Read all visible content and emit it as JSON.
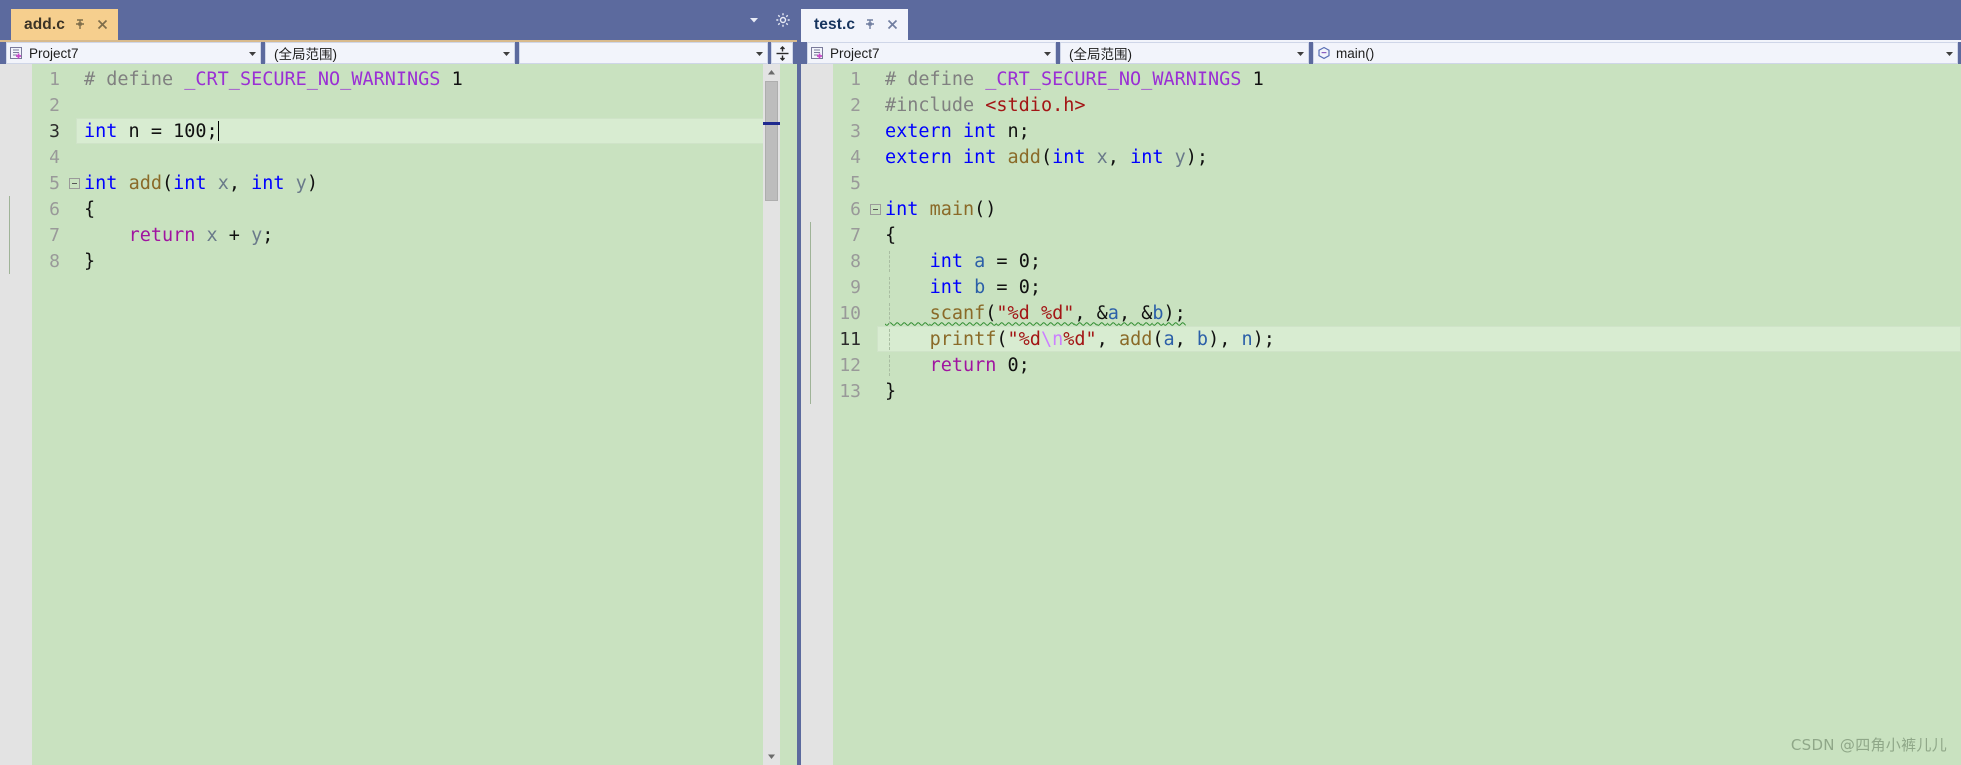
{
  "theme": {
    "chrome_bg": "#5c6a9e",
    "editor_bg": "#c9e2c0",
    "active_tab_bg": "#f6cf8e",
    "focus_tab_bg": "#f2f4fb",
    "current_line_bg": "#d8ecd1",
    "gutter_bg": "#e3e3e3",
    "scroll_marker": "#1f2a8f",
    "keyword": "#0000ff",
    "control": "#a014a0",
    "function": "#8a6a28",
    "string": "#a31515",
    "escape": "#cc80ff",
    "macro": "#9a2fd4",
    "preprocessor": "#808080",
    "squiggle": "#2e8b2e"
  },
  "left_pane": {
    "tab": {
      "label": "add.c",
      "pin_icon": "pin-icon",
      "close_icon": "close-icon",
      "state": "active"
    },
    "strip_icons": [
      {
        "name": "tab-list-chevron-down-icon",
        "glyph": "▾"
      },
      {
        "name": "gear-icon",
        "glyph": "⚙"
      }
    ],
    "navbar": {
      "project_combo": {
        "value": "Project7",
        "icon": "project-add-icon",
        "arrow": "chevron-down-icon"
      },
      "scope_combo": {
        "value": "(全局范围)",
        "arrow": "chevron-down-icon"
      },
      "member_combo": {
        "value": "",
        "arrow": "chevron-down-icon"
      },
      "split_window_icon": "split-window-icon"
    },
    "scrollbar": {
      "up_arrow": "▲",
      "down_arrow": "▼",
      "marker_label": "changed-line-marker"
    },
    "current_line": 3,
    "code_lines": [
      {
        "n": 1,
        "fold": "",
        "tokens": [
          {
            "t": "# define ",
            "c": "t-pre"
          },
          {
            "t": "_CRT_SECURE_NO_WARNINGS",
            "c": "t-macro"
          },
          {
            "t": " 1",
            "c": "t-plain"
          }
        ]
      },
      {
        "n": 2,
        "fold": "",
        "tokens": []
      },
      {
        "n": 3,
        "fold": "",
        "current": true,
        "tokens": [
          {
            "t": "int",
            "c": "t-kw"
          },
          {
            "t": " n ",
            "c": "t-plain"
          },
          {
            "t": "=",
            "c": "t-op"
          },
          {
            "t": " ",
            "c": "t-plain"
          },
          {
            "t": "100",
            "c": "t-num"
          },
          {
            "t": ";",
            "c": "t-plain"
          }
        ],
        "caret": true
      },
      {
        "n": 4,
        "fold": "",
        "tokens": []
      },
      {
        "n": 5,
        "fold": "collapse",
        "tokens": [
          {
            "t": "int",
            "c": "t-kw"
          },
          {
            "t": " ",
            "c": "t-plain"
          },
          {
            "t": "add",
            "c": "t-fn"
          },
          {
            "t": "(",
            "c": "t-plain"
          },
          {
            "t": "int",
            "c": "t-kw"
          },
          {
            "t": " ",
            "c": "t-plain"
          },
          {
            "t": "x",
            "c": "t-var"
          },
          {
            "t": ", ",
            "c": "t-plain"
          },
          {
            "t": "int",
            "c": "t-kw"
          },
          {
            "t": " ",
            "c": "t-plain"
          },
          {
            "t": "y",
            "c": "t-var"
          },
          {
            "t": ")",
            "c": "t-plain"
          }
        ]
      },
      {
        "n": 6,
        "fold": "bar",
        "tokens": [
          {
            "t": "{",
            "c": "t-plain"
          }
        ]
      },
      {
        "n": 7,
        "fold": "bar",
        "tokens": [
          {
            "t": "    ",
            "c": "t-plain"
          },
          {
            "t": "return",
            "c": "t-ctl"
          },
          {
            "t": " ",
            "c": "t-plain"
          },
          {
            "t": "x",
            "c": "t-var"
          },
          {
            "t": " + ",
            "c": "t-plain"
          },
          {
            "t": "y",
            "c": "t-var"
          },
          {
            "t": ";",
            "c": "t-plain"
          }
        ]
      },
      {
        "n": 8,
        "fold": "bar",
        "tokens": [
          {
            "t": "}",
            "c": "t-plain"
          }
        ]
      }
    ]
  },
  "right_pane": {
    "tab": {
      "label": "test.c",
      "pin_icon": "pin-icon",
      "close_icon": "close-icon",
      "state": "focused"
    },
    "navbar": {
      "project_combo": {
        "value": "Project7",
        "icon": "project-add-icon",
        "arrow": "chevron-down-icon"
      },
      "scope_combo": {
        "value": "(全局范围)",
        "arrow": "chevron-down-icon"
      },
      "member_combo": {
        "value": "main()",
        "icon": "method-icon",
        "arrow": "chevron-down-icon"
      }
    },
    "current_line": 11,
    "code_lines": [
      {
        "n": 1,
        "fold": "",
        "tokens": [
          {
            "t": "# define ",
            "c": "t-pre"
          },
          {
            "t": "_CRT_SECURE_NO_WARNINGS",
            "c": "t-macro"
          },
          {
            "t": " 1",
            "c": "t-plain"
          }
        ]
      },
      {
        "n": 2,
        "fold": "",
        "tokens": [
          {
            "t": "#include ",
            "c": "t-pre"
          },
          {
            "t": "<stdio.h>",
            "c": "t-inc"
          }
        ]
      },
      {
        "n": 3,
        "fold": "",
        "tokens": [
          {
            "t": "extern",
            "c": "t-kw"
          },
          {
            "t": " ",
            "c": "t-plain"
          },
          {
            "t": "int",
            "c": "t-kw"
          },
          {
            "t": " n;",
            "c": "t-plain"
          }
        ]
      },
      {
        "n": 4,
        "fold": "",
        "tokens": [
          {
            "t": "extern",
            "c": "t-kw"
          },
          {
            "t": " ",
            "c": "t-plain"
          },
          {
            "t": "int",
            "c": "t-kw"
          },
          {
            "t": " ",
            "c": "t-plain"
          },
          {
            "t": "add",
            "c": "t-fn"
          },
          {
            "t": "(",
            "c": "t-plain"
          },
          {
            "t": "int",
            "c": "t-kw"
          },
          {
            "t": " ",
            "c": "t-plain"
          },
          {
            "t": "x",
            "c": "t-var"
          },
          {
            "t": ", ",
            "c": "t-plain"
          },
          {
            "t": "int",
            "c": "t-kw"
          },
          {
            "t": " ",
            "c": "t-plain"
          },
          {
            "t": "y",
            "c": "t-var"
          },
          {
            "t": ");",
            "c": "t-plain"
          }
        ]
      },
      {
        "n": 5,
        "fold": "",
        "tokens": []
      },
      {
        "n": 6,
        "fold": "collapse",
        "tokens": [
          {
            "t": "int",
            "c": "t-kw"
          },
          {
            "t": " ",
            "c": "t-plain"
          },
          {
            "t": "main",
            "c": "t-fn"
          },
          {
            "t": "()",
            "c": "t-plain"
          }
        ]
      },
      {
        "n": 7,
        "fold": "bar",
        "tokens": [
          {
            "t": "{",
            "c": "t-plain"
          }
        ]
      },
      {
        "n": 8,
        "fold": "bar",
        "dashed": true,
        "tokens": [
          {
            "t": "    ",
            "c": "t-plain"
          },
          {
            "t": "int",
            "c": "t-kw"
          },
          {
            "t": " ",
            "c": "t-plain"
          },
          {
            "t": "a",
            "c": "t-varb"
          },
          {
            "t": " = ",
            "c": "t-plain"
          },
          {
            "t": "0",
            "c": "t-num"
          },
          {
            "t": ";",
            "c": "t-plain"
          }
        ]
      },
      {
        "n": 9,
        "fold": "bar",
        "dashed": true,
        "tokens": [
          {
            "t": "    ",
            "c": "t-plain"
          },
          {
            "t": "int",
            "c": "t-kw"
          },
          {
            "t": " ",
            "c": "t-plain"
          },
          {
            "t": "b",
            "c": "t-varb"
          },
          {
            "t": " = ",
            "c": "t-plain"
          },
          {
            "t": "0",
            "c": "t-num"
          },
          {
            "t": ";",
            "c": "t-plain"
          }
        ]
      },
      {
        "n": 10,
        "fold": "bar",
        "dashed": true,
        "squiggle": true,
        "tokens": [
          {
            "t": "    ",
            "c": "t-plain"
          },
          {
            "t": "scanf",
            "c": "t-fn"
          },
          {
            "t": "(",
            "c": "t-plain"
          },
          {
            "t": "\"%d %d\"",
            "c": "t-str"
          },
          {
            "t": ", ",
            "c": "t-plain"
          },
          {
            "t": "&",
            "c": "t-plain"
          },
          {
            "t": "a",
            "c": "t-varb"
          },
          {
            "t": ", ",
            "c": "t-plain"
          },
          {
            "t": "&",
            "c": "t-plain"
          },
          {
            "t": "b",
            "c": "t-varb"
          },
          {
            "t": ");",
            "c": "t-plain"
          }
        ]
      },
      {
        "n": 11,
        "fold": "bar",
        "dashed": true,
        "current": true,
        "tokens": [
          {
            "t": "    ",
            "c": "t-plain"
          },
          {
            "t": "printf",
            "c": "t-fn"
          },
          {
            "t": "(",
            "c": "t-plain"
          },
          {
            "t": "\"%d",
            "c": "t-str"
          },
          {
            "t": "\\n",
            "c": "t-esc"
          },
          {
            "t": "%d\"",
            "c": "t-str"
          },
          {
            "t": ", ",
            "c": "t-plain"
          },
          {
            "t": "add",
            "c": "t-fn"
          },
          {
            "t": "(",
            "c": "t-plain"
          },
          {
            "t": "a",
            "c": "t-varb"
          },
          {
            "t": ", ",
            "c": "t-plain"
          },
          {
            "t": "b",
            "c": "t-varb"
          },
          {
            "t": "), ",
            "c": "t-plain"
          },
          {
            "t": "n",
            "c": "t-varb"
          },
          {
            "t": ");",
            "c": "t-plain"
          }
        ]
      },
      {
        "n": 12,
        "fold": "bar",
        "dashed": true,
        "tokens": [
          {
            "t": "    ",
            "c": "t-plain"
          },
          {
            "t": "return",
            "c": "t-ctl"
          },
          {
            "t": " ",
            "c": "t-plain"
          },
          {
            "t": "0",
            "c": "t-num"
          },
          {
            "t": ";",
            "c": "t-plain"
          }
        ]
      },
      {
        "n": 13,
        "fold": "bar",
        "tokens": [
          {
            "t": "}",
            "c": "t-plain"
          }
        ]
      }
    ]
  },
  "watermark": {
    "text": "CSDN @四角小裤儿儿"
  }
}
